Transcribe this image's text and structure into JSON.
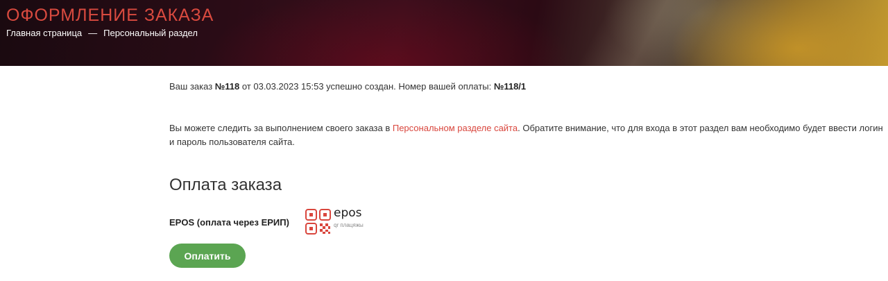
{
  "header": {
    "title": "ОФОРМЛЕНИЕ ЗАКАЗА",
    "breadcrumb": {
      "home": "Главная страница",
      "separator": "—",
      "current": "Персональный раздел"
    }
  },
  "order": {
    "prefix": "Ваш заказ ",
    "number": "№118",
    "middle": " от 03.03.2023 15:53 успешно создан. Номер вашей оплаты: ",
    "payment_number": "№118/1"
  },
  "tracking": {
    "before": "Вы можете следить за выполнением своего заказа в ",
    "link": "Персональном разделе сайта",
    "after": ". Обратите внимание, что для входа в этот раздел вам необходимо будет ввести логин и пароль пользователя сайта."
  },
  "payment": {
    "title": "Оплата заказа",
    "method_label": "EPOS (оплата через ЕРИП)",
    "logo_word": "epos",
    "logo_sub": "qr плацяжы",
    "button_label": "Оплатить"
  },
  "colors": {
    "accent": "#d94a3f",
    "button": "#5ba552"
  }
}
